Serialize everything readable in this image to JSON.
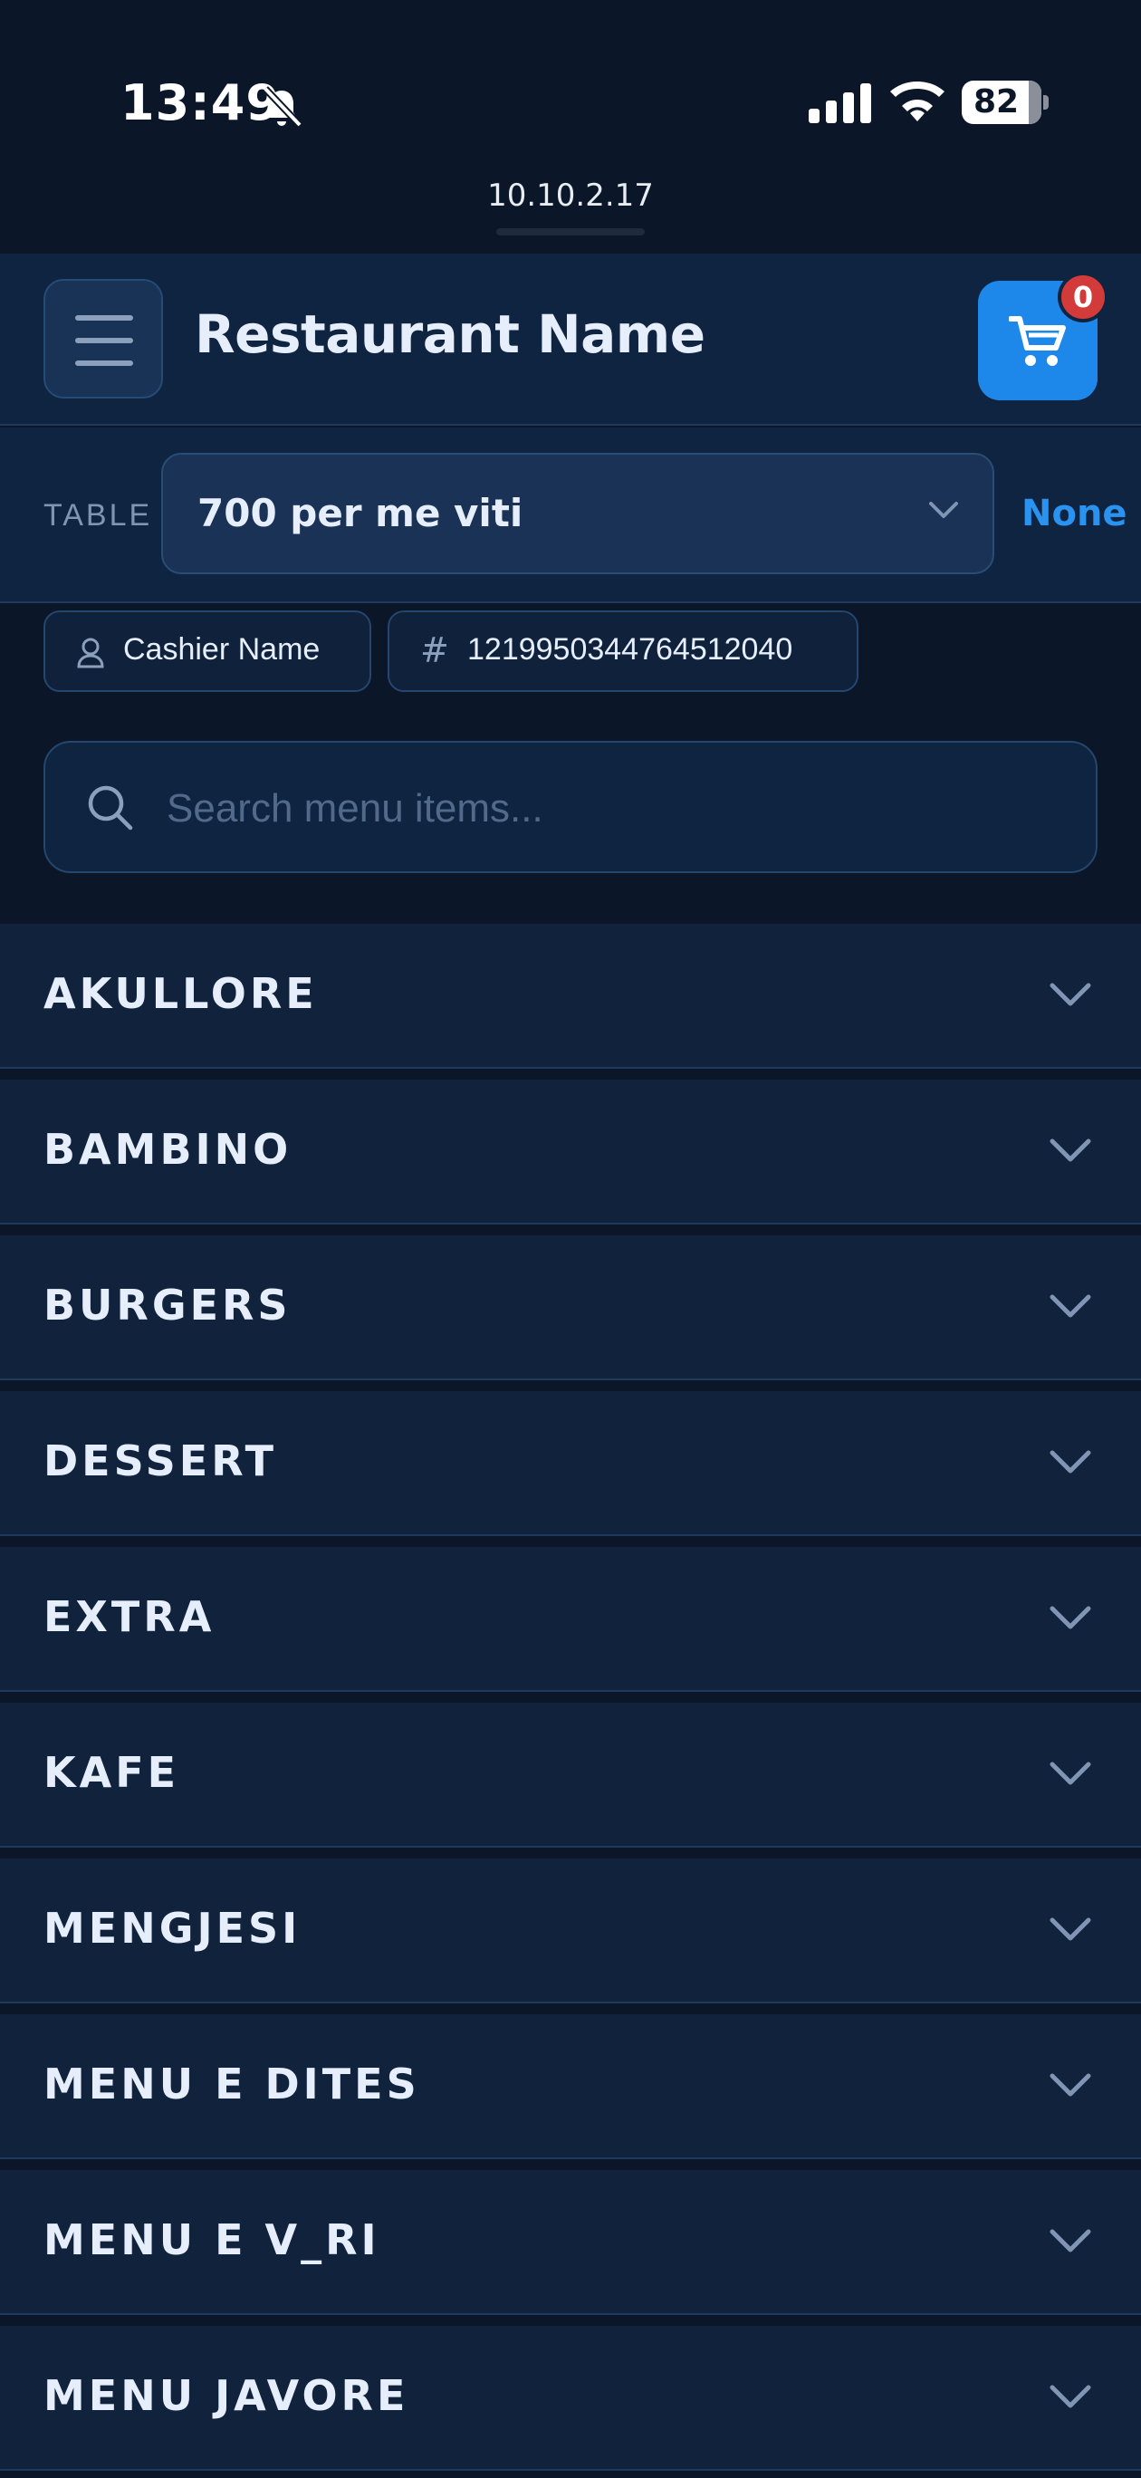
{
  "status": {
    "time": "13:49",
    "battery": "82",
    "url": "10.10.2.17"
  },
  "header": {
    "title": "Restaurant Name",
    "cart_count": "0"
  },
  "table": {
    "label": "TABLE",
    "selected": "700 per me viti",
    "status": "None"
  },
  "chips": {
    "cashier": "Cashier Name",
    "order_id": "1219950344764512040"
  },
  "search": {
    "placeholder": "Search menu items..."
  },
  "categories": [
    {
      "label": "AKULLORE"
    },
    {
      "label": "BAMBINO"
    },
    {
      "label": "BURGERS"
    },
    {
      "label": "DESSERT"
    },
    {
      "label": "EXTRA"
    },
    {
      "label": "KAFE"
    },
    {
      "label": "MENGJESI"
    },
    {
      "label": "MENU E DITES"
    },
    {
      "label": "MENU E V_RI"
    },
    {
      "label": "MENU JAVORE"
    }
  ],
  "colors": {
    "background": "#0b1628",
    "accent": "#1e88ea",
    "badge": "#d33a3a"
  }
}
